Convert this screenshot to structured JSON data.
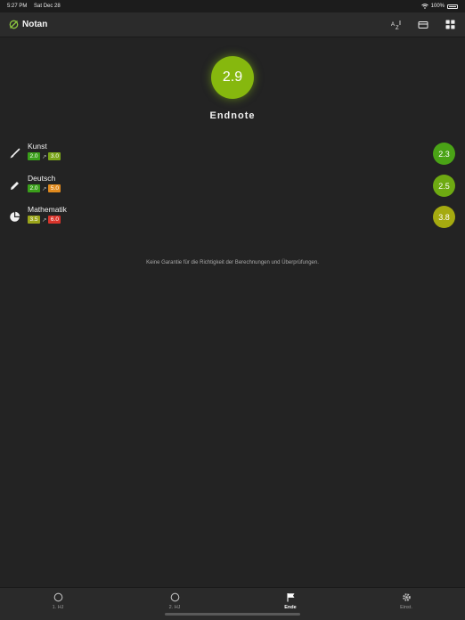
{
  "status_bar": {
    "time": "5:27 PM",
    "date": "Sat Dec 28",
    "battery": "100%"
  },
  "nav": {
    "title": "Notan",
    "title_icon": "slashed-circle-icon",
    "actions": [
      {
        "icon": "sort-az-icon"
      },
      {
        "icon": "card-icon"
      },
      {
        "icon": "grid-icon"
      }
    ]
  },
  "final": {
    "value": "2.9",
    "label": "Endnote",
    "color": "#86b80e"
  },
  "subjects": [
    {
      "name": "Kunst",
      "icon": "paintbrush-icon",
      "from": "2.0",
      "to": "3.0",
      "from_color": "#3a9e1a",
      "to_color": "#7aa51a",
      "result": "2.3",
      "result_color": "#4aa316"
    },
    {
      "name": "Deutsch",
      "icon": "pencil-icon",
      "from": "2.0",
      "to": "5.0",
      "from_color": "#3a9e1a",
      "to_color": "#e08a1e",
      "result": "2.5",
      "result_color": "#6eaa12"
    },
    {
      "name": "Mathematik",
      "icon": "pie-chart-icon",
      "from": "3.5",
      "to": "6.0",
      "from_color": "#9aa41a",
      "to_color": "#d9342b",
      "result": "3.8",
      "result_color": "#a5aa10"
    }
  ],
  "disclaimer": "Keine Garantie für die Richtigkeit der Berechnungen und Überprüfungen.",
  "tabs": [
    {
      "label": "1. HJ",
      "icon": "circle-icon",
      "active": false
    },
    {
      "label": "2. HJ",
      "icon": "circle-icon",
      "active": false
    },
    {
      "label": "Ende",
      "icon": "flag-icon",
      "active": true
    },
    {
      "label": "Einst.",
      "icon": "gear-icon",
      "active": false
    }
  ]
}
